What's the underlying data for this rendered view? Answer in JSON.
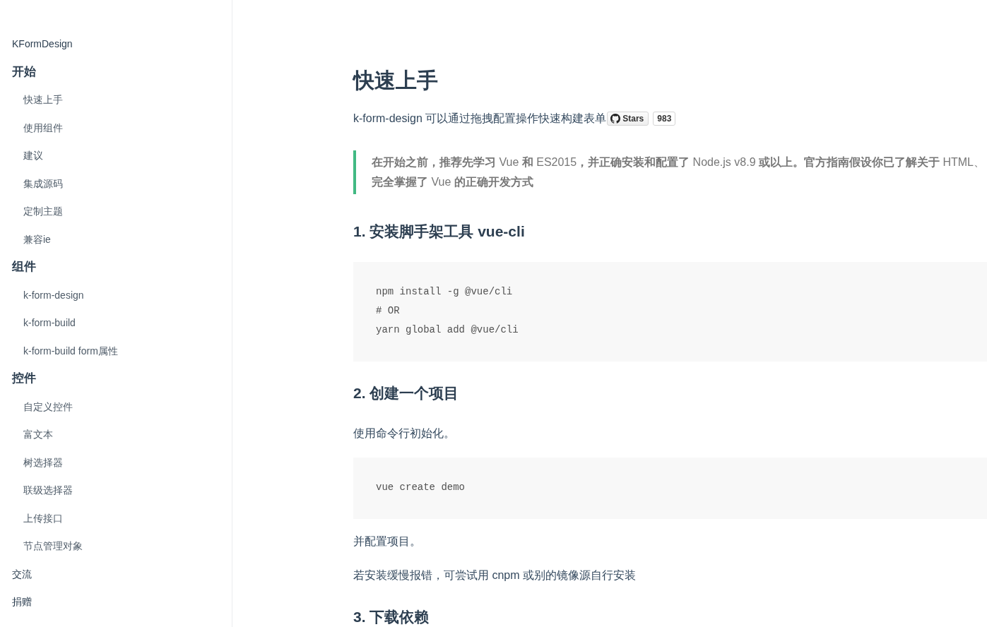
{
  "sidebar": {
    "items": [
      {
        "kind": "top",
        "label": "KFormDesign"
      },
      {
        "kind": "group",
        "label": "开始"
      },
      {
        "kind": "child",
        "label": "快速上手"
      },
      {
        "kind": "child",
        "label": "使用组件"
      },
      {
        "kind": "child",
        "label": "建议"
      },
      {
        "kind": "child",
        "label": "集成源码"
      },
      {
        "kind": "child",
        "label": "定制主题"
      },
      {
        "kind": "child",
        "label": "兼容ie"
      },
      {
        "kind": "group",
        "label": "组件"
      },
      {
        "kind": "child",
        "label": "k-form-design"
      },
      {
        "kind": "child",
        "label": "k-form-build"
      },
      {
        "kind": "child",
        "label": "k-form-build form属性"
      },
      {
        "kind": "group",
        "label": "控件"
      },
      {
        "kind": "child",
        "label": "自定义控件"
      },
      {
        "kind": "child",
        "label": "富文本"
      },
      {
        "kind": "child",
        "label": "树选择器"
      },
      {
        "kind": "child",
        "label": "联级选择器"
      },
      {
        "kind": "child",
        "label": "上传接口"
      },
      {
        "kind": "child",
        "label": "节点管理对象"
      },
      {
        "kind": "top",
        "label": "交流"
      },
      {
        "kind": "top",
        "label": "捐赠"
      }
    ]
  },
  "content": {
    "title": "快速上手",
    "intro": "k-form-design 可以通过拖拽配置操作快速构建表单",
    "stars_badge": {
      "label": "Stars",
      "count": "983"
    },
    "blocks": [
      {
        "kind": "quote",
        "lines": [
          "**在开始之前，推荐先学习** Vue **和** ES2015**，并正确安装和配置了** Node.js v8.9 **或以上。官方指南假设你已了解关于** HTML、",
          "**完全掌握了** Vue **的正确开发方式**"
        ]
      },
      {
        "kind": "heading",
        "text": "1. 安装脚手架工具 vue-cli"
      },
      {
        "kind": "code",
        "lines": [
          "npm install -g @vue/cli",
          "# OR",
          "yarn global add @vue/cli"
        ]
      },
      {
        "kind": "heading",
        "text": "2. 创建一个项目"
      },
      {
        "kind": "para",
        "text": "使用命令行初始化。"
      },
      {
        "kind": "code",
        "lines": [
          "vue create demo"
        ]
      },
      {
        "kind": "para",
        "text": "并配置项目。"
      },
      {
        "kind": "para",
        "text": "若安装缓慢报错，可尝试用 cnpm 或别的镜像源自行安装"
      },
      {
        "kind": "heading",
        "text": "3. 下载依赖"
      }
    ]
  }
}
